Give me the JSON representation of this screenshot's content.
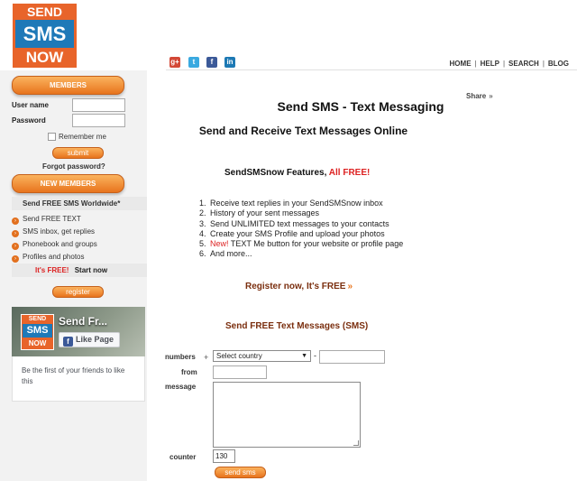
{
  "logo": {
    "line1": "SEND",
    "line2": "SMS",
    "line3": "NOW"
  },
  "social": {
    "google": "g+",
    "twitter": "t",
    "facebook": "f",
    "linkedin": "in"
  },
  "topnav": {
    "items": [
      "HOME",
      "HELP",
      "SEARCH",
      "BLOG"
    ],
    "separator": "|"
  },
  "sidebar": {
    "members_label": "MEMBERS",
    "username_label": "User name",
    "password_label": "Password",
    "remember_label": "Remember me",
    "submit_label": "submit",
    "forgot_label": "Forgot password?",
    "new_members_label": "NEW MEMBERS",
    "worldwide_label": "Send FREE SMS Worldwide*",
    "features": [
      "Send FREE TEXT",
      "SMS inbox, get replies",
      "Phonebook and groups",
      "Profiles and photos"
    ],
    "free_label": "It's FREE!",
    "start_label": "Start now",
    "register_label": "register"
  },
  "facebook": {
    "logo": {
      "line1": "SEND",
      "line2": "SMS",
      "line3": "NOW"
    },
    "page_name": "Send Fr...",
    "like_label": "Like Page",
    "friends_text": "Be the first of your friends to like this"
  },
  "main": {
    "share_label": "Share",
    "share_arrow": "»",
    "title": "Send SMS - Text Messaging",
    "subtitle": "Send and Receive Text Messages Online",
    "features_heading": "SendSMSnow Features,",
    "features_free": "All FREE!",
    "features": [
      {
        "num": "1.",
        "text": "Receive text replies in your SendSMSnow inbox"
      },
      {
        "num": "2.",
        "text": "History of your sent messages"
      },
      {
        "num": "3.",
        "text": "Send UNLIMITED text messages to your contacts"
      },
      {
        "num": "4.",
        "text": "Create your SMS Profile and upload your photos"
      },
      {
        "num": "5.",
        "new": "New!",
        "text": " TEXT Me button for your website or profile page"
      },
      {
        "num": "6.",
        "text": "And more..."
      }
    ],
    "register_now": "Register now, It's FREE",
    "register_arrow": "»",
    "send_free_heading": "Send FREE Text Messages (SMS)"
  },
  "form": {
    "numbers_label": "numbers",
    "plus": "+",
    "country_select": "Select country",
    "dash": "-",
    "from_label": "from",
    "message_label": "message",
    "counter_label": "counter",
    "counter_value": "130",
    "send_label": "send sms"
  },
  "colors": {
    "orange": "#e8741d",
    "blue": "#1e79b8",
    "red": "#d22222",
    "dark_red": "#7a2e0e"
  }
}
